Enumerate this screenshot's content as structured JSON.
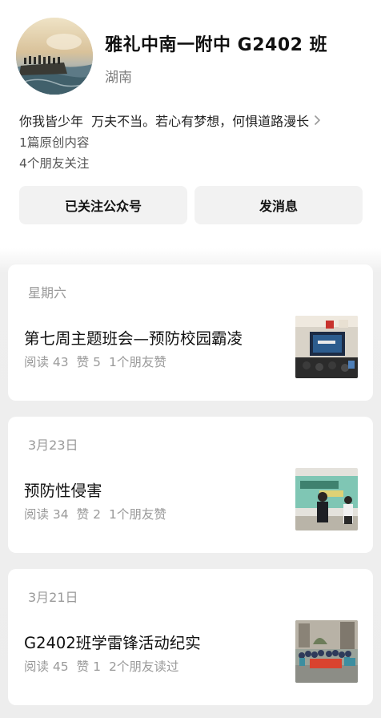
{
  "profile": {
    "name": "雅礼中南一附中 G2402 班",
    "region": "湖南",
    "bio": "你我皆少年  万夫不当。若心有梦想，何惧道路漫长",
    "original_count": "1篇原创内容",
    "friends_following": "4个朋友关注",
    "avatar_icon": "sunset-sea-photo"
  },
  "actions": {
    "follow_label": "已关注公众号",
    "message_label": "发消息"
  },
  "articles": [
    {
      "date": "星期六",
      "title": "第七周主题班会—预防校园霸凌",
      "reads": "阅读 43",
      "likes": "赞 5",
      "friends": "1个朋友赞",
      "thumb_icon": "classroom-projector-photo"
    },
    {
      "date": "3月23日",
      "title": "预防性侵害",
      "reads": "阅读 34",
      "likes": "赞 2",
      "friends": "1个朋友赞",
      "thumb_icon": "presentation-students-photo"
    },
    {
      "date": "3月21日",
      "title": "G2402班学雷锋活动纪实",
      "reads": "阅读 45",
      "likes": "赞 1",
      "friends": "2个朋友读过",
      "thumb_icon": "group-photo-outdoor"
    }
  ],
  "colors": {
    "text_primary": "#111111",
    "text_secondary": "#9a9a9a",
    "button_bg": "#f2f2f2",
    "feed_bg": "#ededed"
  }
}
